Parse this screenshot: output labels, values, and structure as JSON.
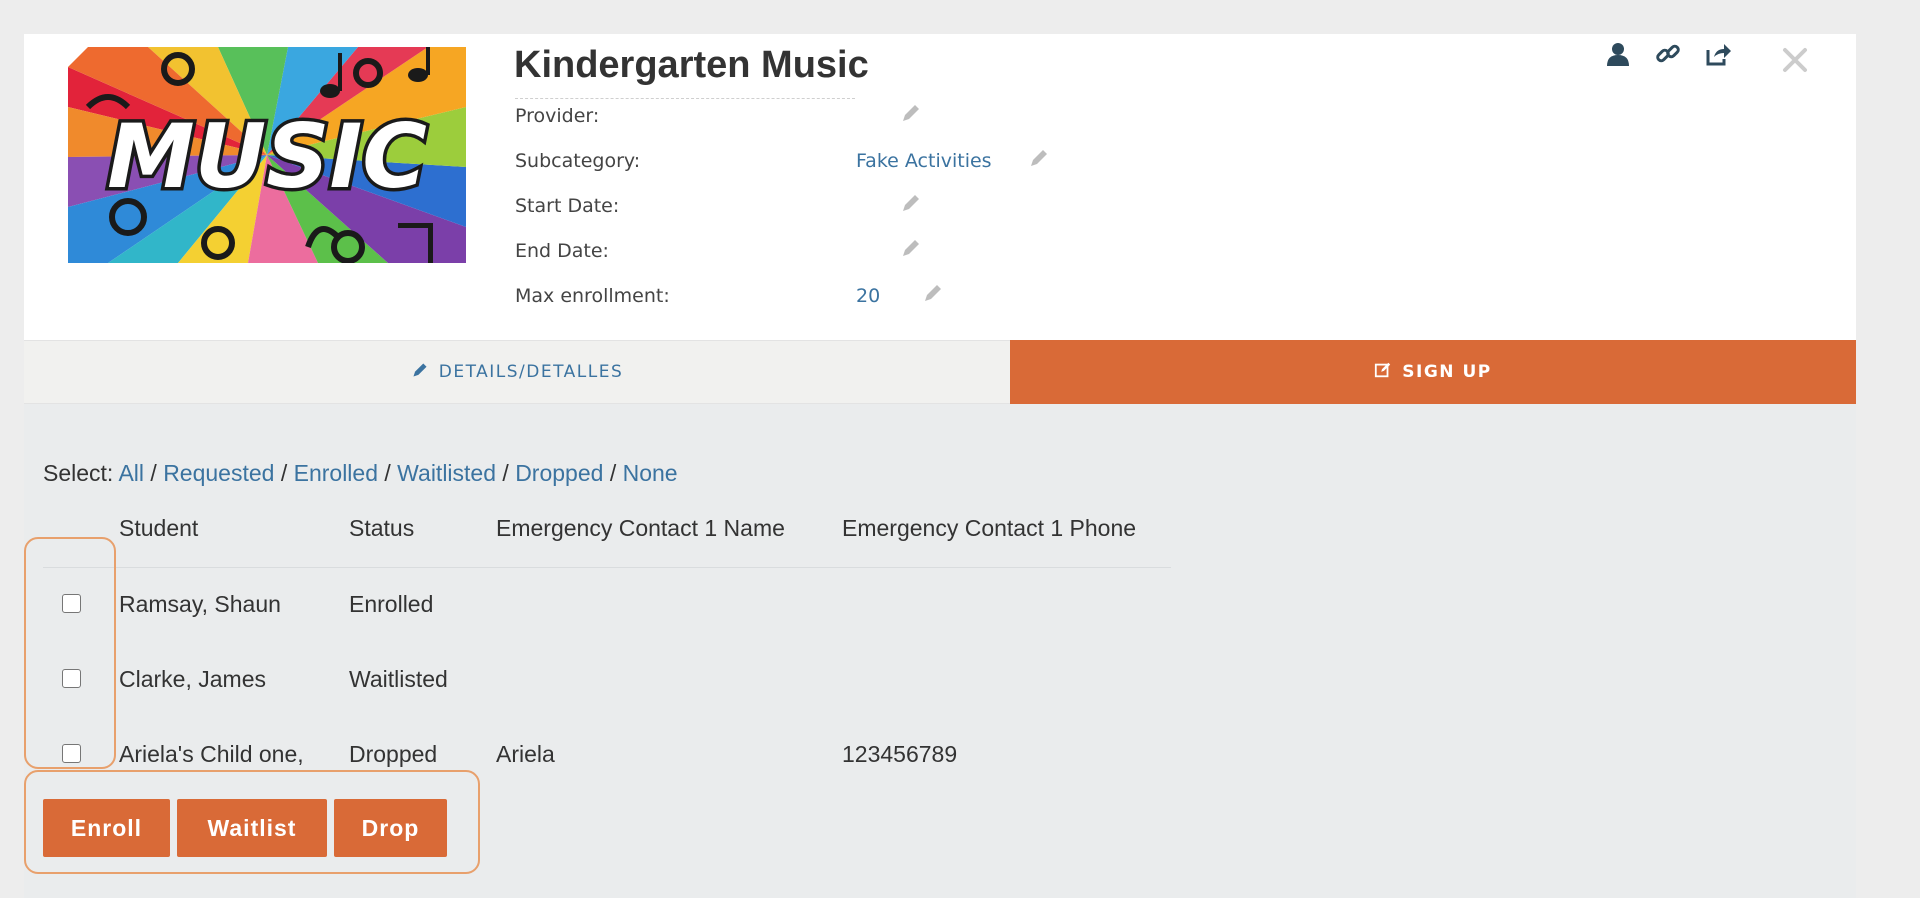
{
  "header": {
    "title": "Kindergarten Music",
    "logo_text": "MUSIC",
    "fields": {
      "provider_label": "Provider:",
      "provider_value": "",
      "subcategory_label": "Subcategory:",
      "subcategory_value": "Fake Activities",
      "start_label": "Start Date:",
      "start_value": "",
      "end_label": "End Date:",
      "end_value": "",
      "max_label": "Max enrollment:",
      "max_value": "20"
    },
    "icons": [
      "user-icon",
      "link-icon",
      "share-icon",
      "close-icon"
    ]
  },
  "tabs": {
    "details_label": "DETAILS/DETALLES",
    "signup_label": "SIGN UP"
  },
  "select": {
    "prefix": "Select:",
    "all": "All",
    "requested": "Requested",
    "enrolled": "Enrolled",
    "waitlisted": "Waitlisted",
    "dropped": "Dropped",
    "none": "None",
    "sep": "/"
  },
  "table": {
    "columns": [
      "Student",
      "Status",
      "Emergency Contact 1 Name",
      "Emergency Contact 1 Phone"
    ],
    "rows": [
      [
        "Ramsay, Shaun",
        "Enrolled",
        "",
        ""
      ],
      [
        "Clarke, James",
        "Waitlisted",
        "",
        ""
      ],
      [
        "Ariela's Child one,",
        "Dropped",
        "Ariela",
        "123456789"
      ]
    ]
  },
  "actions": {
    "enroll": "Enroll",
    "waitlist": "Waitlist",
    "drop": "Drop"
  },
  "colors": {
    "accent": "#d96a37",
    "link": "#3b73a0",
    "highlight": "#e8a06c"
  }
}
